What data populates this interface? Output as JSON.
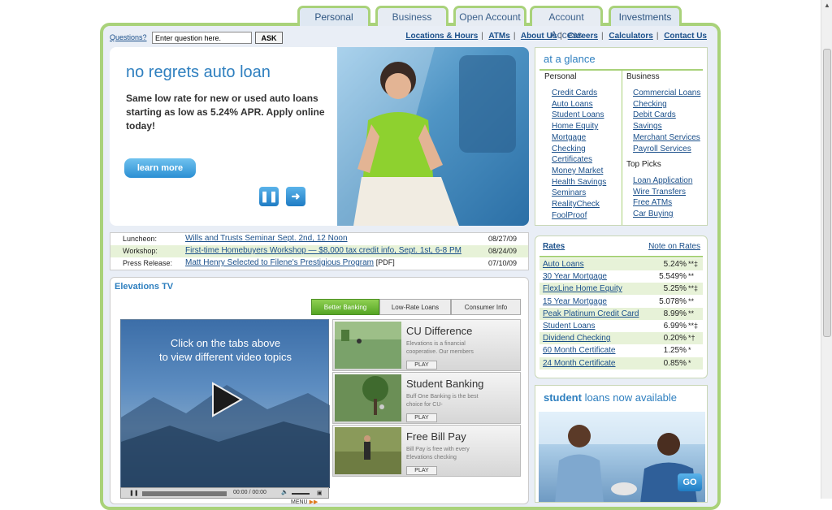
{
  "tabs": [
    "Personal",
    "Business",
    "Open Account",
    "Account Access",
    "Investments"
  ],
  "search": {
    "label": "Questions?",
    "placeholder": "Enter question here.",
    "button": "ASK"
  },
  "toplinks": [
    "Locations & Hours",
    "ATMs",
    "About Us",
    "Careers",
    "Calculators",
    "Contact Us"
  ],
  "hero": {
    "title": "no regrets auto loan",
    "text": "Same low rate for new or used auto loans starting as low as 5.24% APR. Apply online today!",
    "cta": "learn more",
    "pause_icon": "pause-icon",
    "next_icon": "arrow-right-icon"
  },
  "news": [
    {
      "label": "Luncheon:",
      "title": "Wills and Trusts Seminar Sept. 2nd, 12 Noon",
      "suffix": "",
      "date": "08/27/09"
    },
    {
      "label": "Workshop:",
      "title": "First-time Homebuyers Workshop — $8,000 tax credit info, Sept. 1st, 6-8 PM",
      "suffix": "",
      "date": "08/24/09"
    },
    {
      "label": "Press Release:",
      "title": "Matt Henry Selected to Filene's Prestigious Program",
      "suffix": "[PDF]",
      "date": "07/10/09"
    }
  ],
  "tv": {
    "title": "Elevations TV",
    "tabs": [
      "Better Banking",
      "Low-Rate Loans",
      "Consumer Info"
    ],
    "player_msg_1": "Click on the tabs above",
    "player_msg_2": "to view different video topics",
    "time": "00:00 / 00:00",
    "menu": "MENU",
    "videos": [
      {
        "title": "CU Difference",
        "desc": "Elevations is a financial cooperative. Our members",
        "play": "PLAY"
      },
      {
        "title": "Student Banking",
        "desc": "Buff One Banking is the best choice for CU-",
        "play": "PLAY"
      },
      {
        "title": "Free Bill Pay",
        "desc": "Bill Pay is free with every Elevations checking",
        "play": "PLAY"
      }
    ]
  },
  "glance": {
    "title": "at a glance",
    "personal_heading": "Personal",
    "business_heading": "Business",
    "toppicks_heading": "Top Picks",
    "personal": [
      "Credit Cards",
      "Auto Loans",
      "Student Loans",
      "Home Equity",
      "Mortgage",
      "Checking",
      "Certificates",
      "Money Market",
      "Health Savings",
      "Seminars",
      "RealityCheck",
      "FoolProof"
    ],
    "business": [
      "Commercial Loans",
      "Checking",
      "Debit Cards",
      "Savings",
      "Merchant Services",
      "Payroll Services"
    ],
    "toppicks": [
      "Loan Application",
      "Wire Transfers",
      "Free ATMs",
      "Car Buying"
    ]
  },
  "rates": {
    "title": "Rates",
    "note": "Note on Rates",
    "rows": [
      {
        "name": "Auto Loans",
        "value": "5.24%",
        "mark": "**‡"
      },
      {
        "name": "30 Year Mortgage",
        "value": "5.549%",
        "mark": "**"
      },
      {
        "name": "FlexLine Home Equity",
        "value": "5.25%",
        "mark": "**‡"
      },
      {
        "name": "15 Year Mortgage",
        "value": "5.078%",
        "mark": "**"
      },
      {
        "name": "Peak Platinum Credit Card",
        "value": "8.99%",
        "mark": "**"
      },
      {
        "name": "Student Loans",
        "value": "6.99%",
        "mark": "**‡"
      },
      {
        "name": "Dividend Checking",
        "value": "0.20%",
        "mark": "*†"
      },
      {
        "name": "60 Month Certificate",
        "value": "1.25%",
        "mark": "*"
      },
      {
        "name": "24 Month Certificate",
        "value": "0.85%",
        "mark": "*"
      }
    ]
  },
  "ad": {
    "bold": "student",
    "rest": " loans now available",
    "go": "GO"
  },
  "colors": {
    "accent_green": "#a9d27a",
    "link_blue": "#1a4f8a",
    "title_blue": "#2e7fbf"
  }
}
